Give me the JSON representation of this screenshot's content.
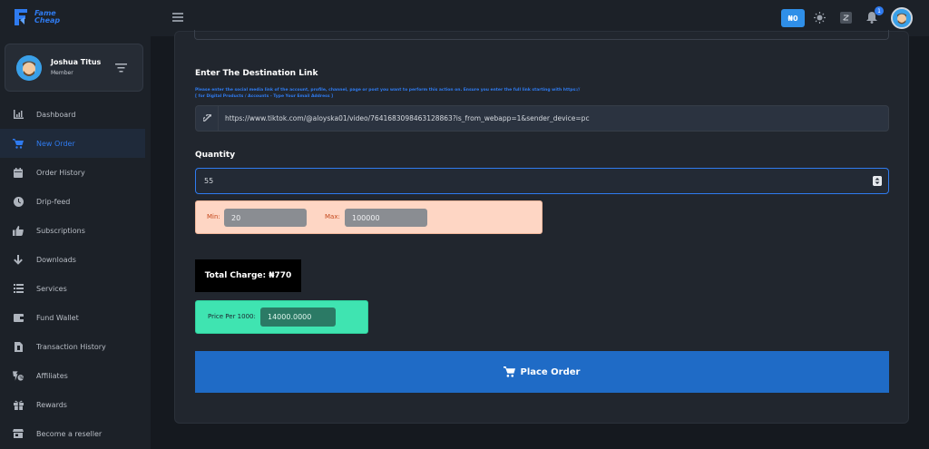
{
  "brand": {
    "line1": "Fame",
    "line2": "Cheap"
  },
  "user": {
    "name": "Joshua Titus",
    "role": "Member"
  },
  "sidebar": {
    "items": [
      {
        "label": "Dashboard",
        "icon": "chart-icon"
      },
      {
        "label": "New Order",
        "icon": "cart-icon",
        "active": true
      },
      {
        "label": "Order History",
        "icon": "calendar-icon"
      },
      {
        "label": "Drip-feed",
        "icon": "clock-icon"
      },
      {
        "label": "Subscriptions",
        "icon": "thumbs-up-icon"
      },
      {
        "label": "Downloads",
        "icon": "arrow-down-icon"
      },
      {
        "label": "Services",
        "icon": "list-icon"
      },
      {
        "label": "Fund Wallet",
        "icon": "wallet-icon"
      },
      {
        "label": "Transaction History",
        "icon": "file-icon"
      },
      {
        "label": "Affiliates",
        "icon": "affiliates-icon"
      },
      {
        "label": "Rewards",
        "icon": "gift-icon"
      },
      {
        "label": "Become a reseller",
        "icon": "store-icon"
      }
    ]
  },
  "topbar": {
    "balance": "₦0",
    "notification_count": "1"
  },
  "form": {
    "destination_label": "Enter The Destination Link",
    "destination_help_1": "Please enter the social media link of the account, profile, channel, page or post you want to perform this action on. Ensure you enter the full link starting with https://",
    "destination_help_2": "[ for Digital Products / Accounts - Type Your Email Address ]",
    "destination_value": "https://www.tiktok.com/@aloyska01/video/7641683098463128863?is_from_webapp=1&sender_device=pc",
    "quantity_label": "Quantity",
    "quantity_value": "55",
    "min_label": "Min:",
    "min_value": "20",
    "max_label": "Max:",
    "max_value": "100000",
    "total_charge": "Total Charge: ₦770",
    "price_label": "Price Per 1000:",
    "price_value": "14000.0000",
    "submit_label": "Place Order"
  },
  "colors": {
    "accent": "#2f7bf0",
    "button": "#1f6bc6",
    "price_box": "#3fe4b1",
    "limits_box": "#fed6c4"
  }
}
